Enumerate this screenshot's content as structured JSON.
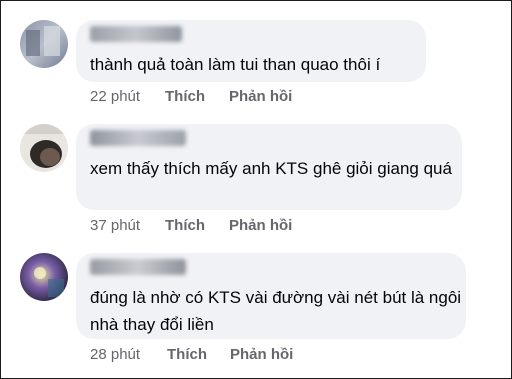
{
  "comments": [
    {
      "text": "thành quả toàn làm tui than quao thôi í",
      "time": "22 phút",
      "like_label": "Thích",
      "reply_label": "Phản hồi"
    },
    {
      "text": "xem thấy thích mấy anh KTS ghê giỏi giang quá",
      "time": "37 phút",
      "like_label": "Thích",
      "reply_label": "Phản hồi"
    },
    {
      "text": "đúng là nhờ có KTS vài đường vài nét bút là ngôi nhà thay đổi liền",
      "time": "28 phút",
      "like_label": "Thích",
      "reply_label": "Phản hồi"
    }
  ]
}
